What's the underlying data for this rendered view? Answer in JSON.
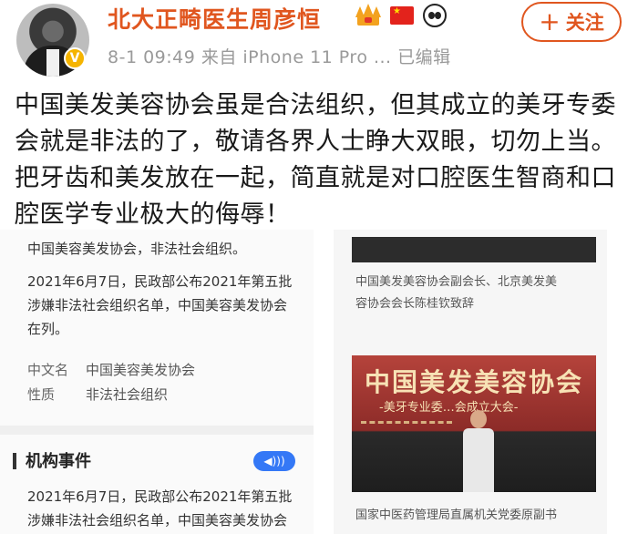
{
  "header": {
    "username": "北大正畸医生周彦恒",
    "meta": "8-1 09:49  来自 iPhone 11 Pro ...  已编辑",
    "follow_label": "关注",
    "badges": [
      "crown-icon",
      "china-flag-icon",
      "panda-icon"
    ],
    "verified_badge": "V"
  },
  "post": {
    "text": "中国美发美容协会虽是合法组织，但其成立的美牙专委会就是非法的了，敬请各界人士睁大双眼，切勿上当。把牙齿和美发放在一起，简直就是对口腔医生智商和口腔医学专业极大的侮辱！"
  },
  "image_left": {
    "line1": "中国美容美发协会，非法社会组织。",
    "line2": "2021年6月7日，民政部公布2021年第五批",
    "line3": "涉嫌非法社会组织名单，中国美容美发协会",
    "line4": "在列。",
    "field1_label": "中文名",
    "field1_value": "中国美容美发协会",
    "field2_label": "性质",
    "field2_value": "非法社会组织",
    "section_title": "机构事件",
    "line5": "2021年6月7日，民政部公布2021年第五批",
    "line6": "涉嫌非法社会组织名单，中国美容美发协会"
  },
  "image_right": {
    "caption1": "中国美发美容协会副会长、北京美发美",
    "caption2": "容协会会长陈桂钦致辞",
    "banner": "中国美发美容协会",
    "banner_sub": "-美牙专业委…会成立大会-",
    "caption3": "国家中医药管理局直属机关党委原副书"
  },
  "colors": {
    "accent": "#e0561f",
    "meta_gray": "#9a9a9a",
    "audio_blue": "#3478f6"
  }
}
